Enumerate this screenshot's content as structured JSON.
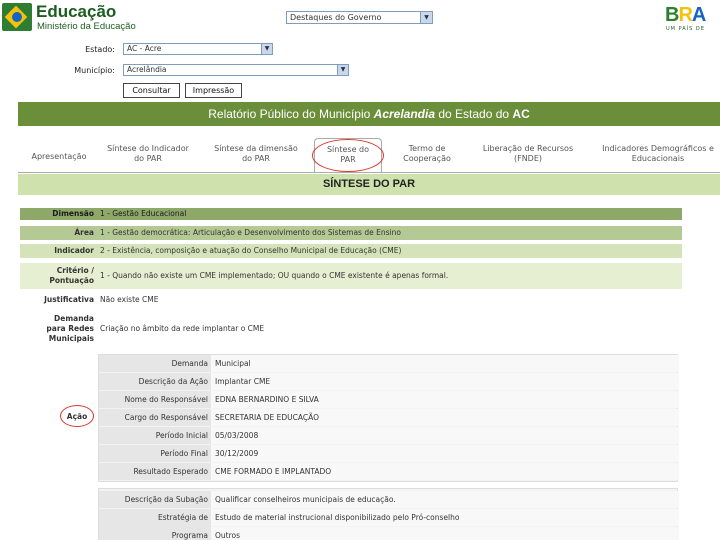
{
  "header": {
    "brand_title": "Educação",
    "brand_sub": "Ministério da Educação",
    "gov_select": "Destaques do Governo",
    "brasil_letters": "BRA",
    "brasil_tag": "UM PAÍS DE"
  },
  "form": {
    "estado_label": "Estado:",
    "estado_value": "AC - Acre",
    "municipio_label": "Município:",
    "municipio_value": "Acrelândia",
    "consultar_label": "Consultar",
    "impressao_label": "Impressão"
  },
  "banner": {
    "prefix": "Relatório Público do Município ",
    "municipio": "Acrelandia",
    "middle": " do Estado do ",
    "estado": "AC"
  },
  "tabs": [
    {
      "line1": "Apresentação",
      "line2": ""
    },
    {
      "line1": "Síntese do Indicador",
      "line2": "do PAR"
    },
    {
      "line1": "Síntese da dimensão",
      "line2": "do PAR"
    },
    {
      "line1": "Síntese do",
      "line2": "PAR"
    },
    {
      "line1": "Termo de",
      "line2": "Cooperação"
    },
    {
      "line1": "Liberação de Recursos",
      "line2": "(FNDE)"
    },
    {
      "line1": "Indicadores Demográficos e",
      "line2": "Educacionais"
    }
  ],
  "sintese_title": "SÍNTESE DO PAR",
  "rows": {
    "dimensao_label": "Dimensão",
    "dimensao_value": "1 - Gestão Educacional",
    "area_label": "Área",
    "area_value": "1 - Gestão democrática: Articulação e Desenvolvimento dos Sistemas de Ensino",
    "indicador_label": "Indicador",
    "indicador_value": "2 - Existência, composição e atuação do Conselho Municipal de Educação (CME)",
    "criterio_label1": "Critério /",
    "criterio_label2": "Pontuação",
    "criterio_value": "1 - Quando não existe um CME implementado; OU quando o CME existente é apenas formal.",
    "justificativa_label": "Justificativa",
    "justificativa_value": "Não existe CME",
    "demanda_label1": "Demanda",
    "demanda_label2": "para Redes",
    "demanda_label3": "Municipais",
    "demanda_value": "Criação no âmbito da rede implantar o CME"
  },
  "acao_label": "Ação",
  "acao": [
    {
      "label": "Demanda",
      "value": "Municipal"
    },
    {
      "label": "Descrição da Ação",
      "value": "Implantar CME"
    },
    {
      "label": "Nome do Responsável",
      "value": "EDNA BERNARDINO E SILVA"
    },
    {
      "label": "Cargo do Responsável",
      "value": "SECRETARIA DE EDUCAÇÃO"
    },
    {
      "label": "Período Inicial",
      "value": "05/03/2008"
    },
    {
      "label": "Período Final",
      "value": "30/12/2009"
    },
    {
      "label": "Resultado Esperado",
      "value": "CME FORMADO E IMPLANTADO"
    }
  ],
  "subacao": [
    {
      "label": "Descrição da Subação",
      "value": "Qualificar conselheiros municipais de educação."
    },
    {
      "label": "Estratégia de Implementação",
      "value": "Estudo de material instrucional disponibilizado pelo Pró-conselho"
    },
    {
      "label": "Programa",
      "value": "Outros"
    }
  ]
}
